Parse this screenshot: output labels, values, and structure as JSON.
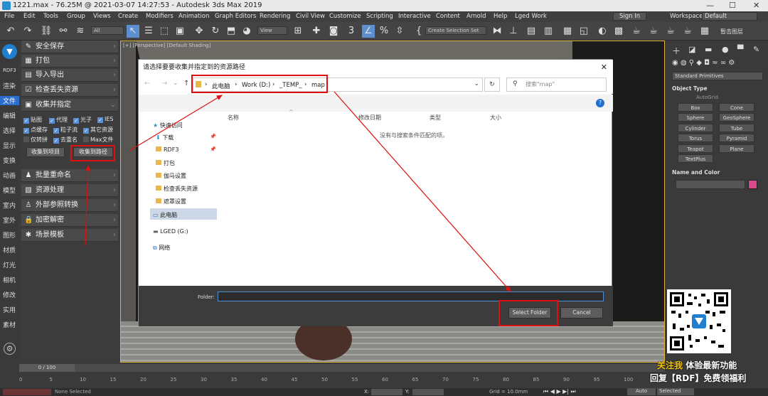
{
  "window": {
    "title": "1221.max - 76.25M @ 2021-03-07 14:27:53 - Autodesk 3ds Max 2019",
    "min": "—",
    "max": "☐",
    "close": "✕"
  },
  "menu": [
    "File",
    "Edit",
    "Tools",
    "Group",
    "Views",
    "Create",
    "Modifiers",
    "Animation",
    "Graph Editors",
    "Rendering",
    "Civil View",
    "Customize",
    "Scripting",
    "Interactive",
    "Content",
    "Arnold",
    "Help",
    "Lged Work"
  ],
  "menu_right": {
    "signin": "Sign In",
    "workspaces_label": "Workspaces:",
    "workspace": "Default"
  },
  "toolbar": {
    "filter": "All",
    "view": "View",
    "selection_set": "Create Selection Set",
    "right_label": "暂击图层"
  },
  "left_strip": [
    "RDF3",
    "渲染",
    "文件",
    "编辑",
    "选择",
    "显示",
    "变换",
    "动画",
    "模型",
    "室内",
    "室外",
    "图形",
    "材质",
    "灯光",
    "相机",
    "修改",
    "实用",
    "素材"
  ],
  "rdf_panel": {
    "items_top": [
      {
        "icon": "✎",
        "label": "安全保存"
      },
      {
        "icon": "▦",
        "label": "打包"
      },
      {
        "icon": "▤",
        "label": "导入导出"
      },
      {
        "icon": "☑",
        "label": "检查丢失资源"
      },
      {
        "icon": "▣",
        "label": "收集并指定"
      }
    ],
    "checkboxes": [
      {
        "label": "贴图",
        "on": true
      },
      {
        "label": "代理",
        "on": true
      },
      {
        "label": "光子",
        "on": true
      },
      {
        "label": "IES",
        "on": true
      },
      {
        "label": "点缓存",
        "on": true
      },
      {
        "label": "粒子流",
        "on": true
      },
      {
        "label": "其它资源",
        "on": true
      },
      {
        "label": "仅转拼",
        "on": false
      },
      {
        "label": "去重名",
        "on": true
      },
      {
        "label": "Max文件",
        "on": false
      }
    ],
    "btn_collect_project": "收集到项目",
    "btn_collect_path": "收集到路径",
    "items_bottom": [
      {
        "icon": "♟",
        "label": "批量重命名"
      },
      {
        "icon": "▧",
        "label": "资源处理"
      },
      {
        "icon": "♙",
        "label": "外部参照转换"
      },
      {
        "icon": "🔒",
        "label": "加密解密"
      },
      {
        "icon": "✱",
        "label": "场景模板"
      }
    ]
  },
  "viewport": {
    "label": "[+] [Perspective] [Default Shading]"
  },
  "dialog": {
    "title": "请选择要要收集并指定到的资源路径",
    "close": "✕",
    "breadcrumb": [
      "此电脑",
      "Work (D:)",
      "_TEMP_",
      "map"
    ],
    "search_placeholder": "搜索\"map\"",
    "columns": [
      "名称",
      "修改日期",
      "类型",
      "大小"
    ],
    "empty_message": "没有与搜索条件匹配的项。",
    "nav": [
      {
        "label": "快速访问",
        "kind": "star"
      },
      {
        "label": "下载",
        "kind": "down"
      },
      {
        "label": "RDF3",
        "kind": "folder"
      },
      {
        "label": "打包",
        "kind": "folder"
      },
      {
        "label": "伽马设置",
        "kind": "folder"
      },
      {
        "label": "检查丢失资源",
        "kind": "folder"
      },
      {
        "label": "遮罩设置",
        "kind": "folder"
      },
      {
        "label": "此电脑",
        "kind": "pc"
      },
      {
        "label": "LGED (G:)",
        "kind": "drive"
      },
      {
        "label": "网络",
        "kind": "net"
      }
    ],
    "folder_label": "Folder:",
    "folder_value": "",
    "select_button": "Select Folder",
    "cancel_button": "Cancel"
  },
  "command_panel": {
    "category": "Standard Primitives",
    "object_type_title": "Object Type",
    "autogrid": "AutoGrid",
    "objects": [
      "Box",
      "Cone",
      "Sphere",
      "GeoSphere",
      "Cylinder",
      "Tube",
      "Torus",
      "Pyramid",
      "Teapot",
      "Plane",
      "TextPlus"
    ],
    "name_color_title": "Name and Color",
    "color": "#d94a8c"
  },
  "timeline": {
    "frame": "0 / 100",
    "ticks": [
      "0",
      "5",
      "10",
      "15",
      "20",
      "25",
      "30",
      "35",
      "40",
      "45",
      "50",
      "55",
      "60",
      "65",
      "70",
      "75",
      "80",
      "85",
      "90",
      "95",
      "100"
    ],
    "status_left": "None Selected",
    "x_label": "X:",
    "x_value": "",
    "y_label": "Y:",
    "y_value": "",
    "grid": "Grid = 10.0mm",
    "auto": "Auto",
    "selected": "Selected"
  },
  "overlay": {
    "line1_a": "关注我",
    "line1_b": "体验最新功能",
    "line2": "回复【RDF】免费领福利"
  },
  "colors": {
    "annotation_red": "#e01010",
    "accent_blue": "#2a6fd0",
    "swatch": "#d94a8c"
  }
}
